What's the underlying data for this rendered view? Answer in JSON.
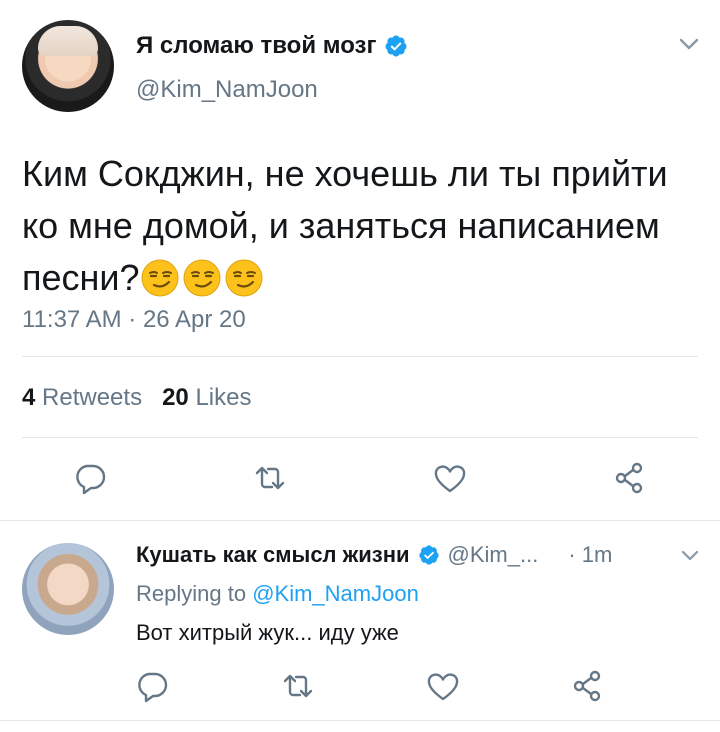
{
  "tweet": {
    "display_name": "Я сломаю твой мозг",
    "handle": "@Kim_NamJoon",
    "verified": true,
    "text": "Ким Сокджин, не хочешь ли ты прийти ко мне домой, и заняться написанием песни?",
    "emojis": [
      "smirking-face",
      "smirking-face",
      "smirking-face"
    ],
    "timestamp": "11:37 AM · 26 Apr 20",
    "retweets_count": "4",
    "retweets_label": "Retweets",
    "likes_count": "20",
    "likes_label": "Likes"
  },
  "reply": {
    "display_name": "Кушать как смысл жизни",
    "handle": "@Kim_...",
    "verified": true,
    "time": "· 1m",
    "replying_prefix": "Replying to",
    "replying_to": "@Kim_NamJoon",
    "text": "Вот хитрый жук... иду уже"
  },
  "colors": {
    "accent": "#1da1f2",
    "secondary_text": "#657786",
    "divider": "#e1e8ed",
    "emoji": "#fcc21b"
  }
}
